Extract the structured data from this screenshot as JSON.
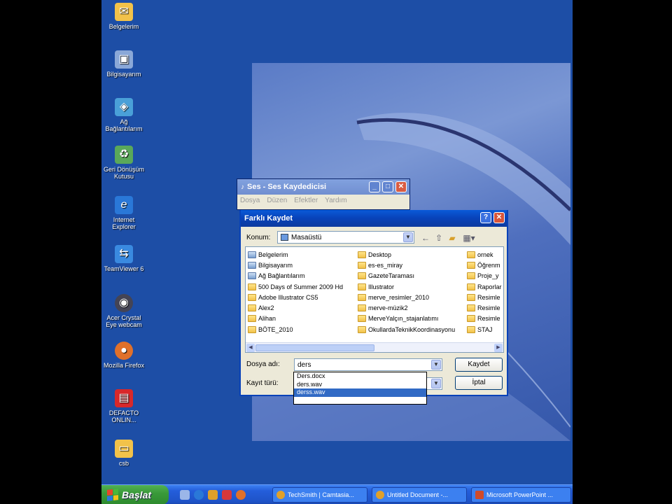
{
  "desktop_icons": [
    {
      "label": "Belgelerim",
      "icon": "documents-folder-icon",
      "color": "#f2c24a"
    },
    {
      "label": "Bilgisayarım",
      "icon": "computer-icon",
      "color": "#8aa8d8"
    },
    {
      "label": "Ağ Bağlantılarım",
      "icon": "network-icon",
      "color": "#4aa0d8"
    },
    {
      "label": "Geri Dönüşüm Kutusu",
      "icon": "recycle-bin-icon",
      "color": "#5aa85a"
    },
    {
      "label": "Internet Explorer",
      "icon": "internet-explorer-icon",
      "color": "#2a78d8"
    },
    {
      "label": "TeamViewer 6",
      "icon": "teamviewer-icon",
      "color": "#3a8ae0"
    },
    {
      "label": "Acer Crystal Eye webcam",
      "icon": "webcam-icon",
      "color": "#445"
    },
    {
      "label": "Mozilla Firefox",
      "icon": "firefox-icon",
      "color": "#e0702a"
    },
    {
      "label": "DEFACTO ONLIN...",
      "icon": "defacto-icon",
      "color": "#d8282a"
    },
    {
      "label": "csb",
      "icon": "folder-icon",
      "color": "#f2c24a"
    }
  ],
  "recorder": {
    "title": "Ses - Ses Kaydedicisi",
    "menu": [
      "Dosya",
      "Düzen",
      "Efektler",
      "Yardım"
    ]
  },
  "save_dialog": {
    "title": "Farklı Kaydet",
    "location_label": "Konum:",
    "location_value": "Masaüstü",
    "filename_label": "Dosya adı:",
    "filename_value": "ders",
    "filetype_label": "Kayıt türü:",
    "save_button": "Kaydet",
    "cancel_button": "İptal",
    "files_col1": [
      {
        "name": "Belgelerim",
        "type": "system"
      },
      {
        "name": "Bilgisayarım",
        "type": "system"
      },
      {
        "name": "Ağ Bağlantılarım",
        "type": "system"
      },
      {
        "name": "500 Days of Summer 2009 Hd",
        "type": "folder"
      },
      {
        "name": "Adobe Illustrator CS5",
        "type": "folder"
      },
      {
        "name": "Alex2",
        "type": "folder"
      },
      {
        "name": "Alihan",
        "type": "folder"
      },
      {
        "name": "BÖTE_2010",
        "type": "folder"
      }
    ],
    "files_col2": [
      {
        "name": "Desktop",
        "type": "folder"
      },
      {
        "name": "es-es_miray",
        "type": "folder"
      },
      {
        "name": "GazeteTaraması",
        "type": "folder"
      },
      {
        "name": "Illustrator",
        "type": "folder"
      },
      {
        "name": "merve_resimler_2010",
        "type": "folder"
      },
      {
        "name": "merve-müzik2",
        "type": "folder"
      },
      {
        "name": "MerveYalçın_stajanlatımı",
        "type": "folder"
      },
      {
        "name": "OkullardaTeknikKoordinasyonu",
        "type": "folder"
      }
    ],
    "files_col3": [
      {
        "name": "ornek",
        "type": "folder"
      },
      {
        "name": "Öğrenm",
        "type": "folder"
      },
      {
        "name": "Proje_y",
        "type": "folder"
      },
      {
        "name": "Raporlar",
        "type": "folder"
      },
      {
        "name": "Resimle",
        "type": "folder"
      },
      {
        "name": "Resimle",
        "type": "folder"
      },
      {
        "name": "Resimle",
        "type": "folder"
      },
      {
        "name": "STAJ",
        "type": "folder"
      }
    ]
  },
  "autocomplete": [
    "Ders.docx",
    "ders.wav",
    "derss.wav"
  ],
  "taskbar": {
    "start_label": "Başlat",
    "tasks": [
      {
        "label": "TechSmith | Camtasia...",
        "color": "#e0a02a"
      },
      {
        "label": "Untitled Document -...",
        "color": "#e0a02a"
      },
      {
        "label": "Microsoft PowerPoint ...",
        "color": "#d04a2a"
      }
    ]
  }
}
